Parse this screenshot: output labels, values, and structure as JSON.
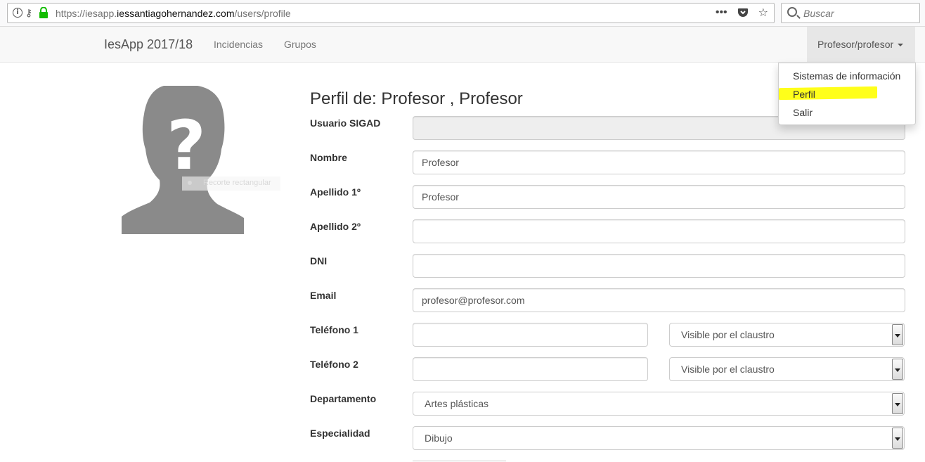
{
  "browser": {
    "url_prefix": "https://iesapp.",
    "url_domain": "iessantiagohernandez.com",
    "url_path": "/users/profile",
    "search_placeholder": "Buscar",
    "more_glyph": "•••"
  },
  "navbar": {
    "brand": "IesApp 2017/18",
    "links": [
      "Incidencias",
      "Grupos"
    ],
    "user_menu": "Profesor/profesor"
  },
  "dropdown": {
    "items": [
      "Sistemas de información",
      "Perfil",
      "Salir"
    ],
    "highlight_color": "#ffff1a"
  },
  "overlay": {
    "text": "Recorte rectangular"
  },
  "profile": {
    "title": "Perfil de: Profesor , Profesor",
    "fields": {
      "usuario_sigad": {
        "label": "Usuario SIGAD",
        "value": ""
      },
      "nombre": {
        "label": "Nombre",
        "value": "Profesor"
      },
      "apellido1": {
        "label": "Apellido 1º",
        "value": "Profesor"
      },
      "apellido2": {
        "label": "Apellido 2º",
        "value": ""
      },
      "dni": {
        "label": "DNI",
        "value": ""
      },
      "email": {
        "label": "Email",
        "value": "profesor@profesor.com"
      },
      "telefono1": {
        "label": "Teléfono 1",
        "value": "",
        "visibility": "Visible por el claustro"
      },
      "telefono2": {
        "label": "Teléfono 2",
        "value": "",
        "visibility": "Visible por el claustro"
      },
      "departamento": {
        "label": "Departamento",
        "value": "Artes plásticas"
      },
      "especialidad": {
        "label": "Especialidad",
        "value": "Dibujo"
      }
    }
  }
}
